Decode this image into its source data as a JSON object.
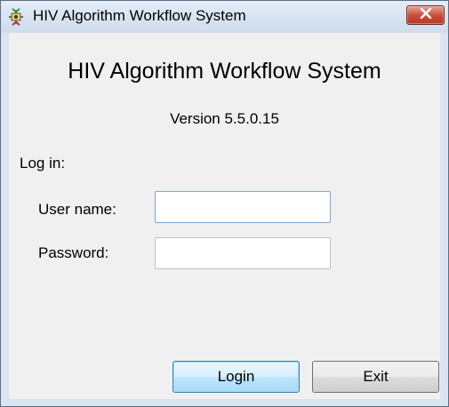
{
  "window": {
    "title": "HIV Algorithm Workflow System"
  },
  "main": {
    "heading": "HIV Algorithm Workflow System",
    "version": "Version 5.5.0.15",
    "login_label": "Log in:",
    "username": {
      "label": "User name:",
      "value": "",
      "placeholder": ""
    },
    "password": {
      "label": "Password:",
      "value": "",
      "placeholder": ""
    }
  },
  "buttons": {
    "login": "Login",
    "exit": "Exit"
  },
  "colors": {
    "titlebar": "#dae5f2",
    "close_button": "#c74a35",
    "client_background": "#f0f0f0",
    "default_button_accent": "#3c7fb1"
  }
}
